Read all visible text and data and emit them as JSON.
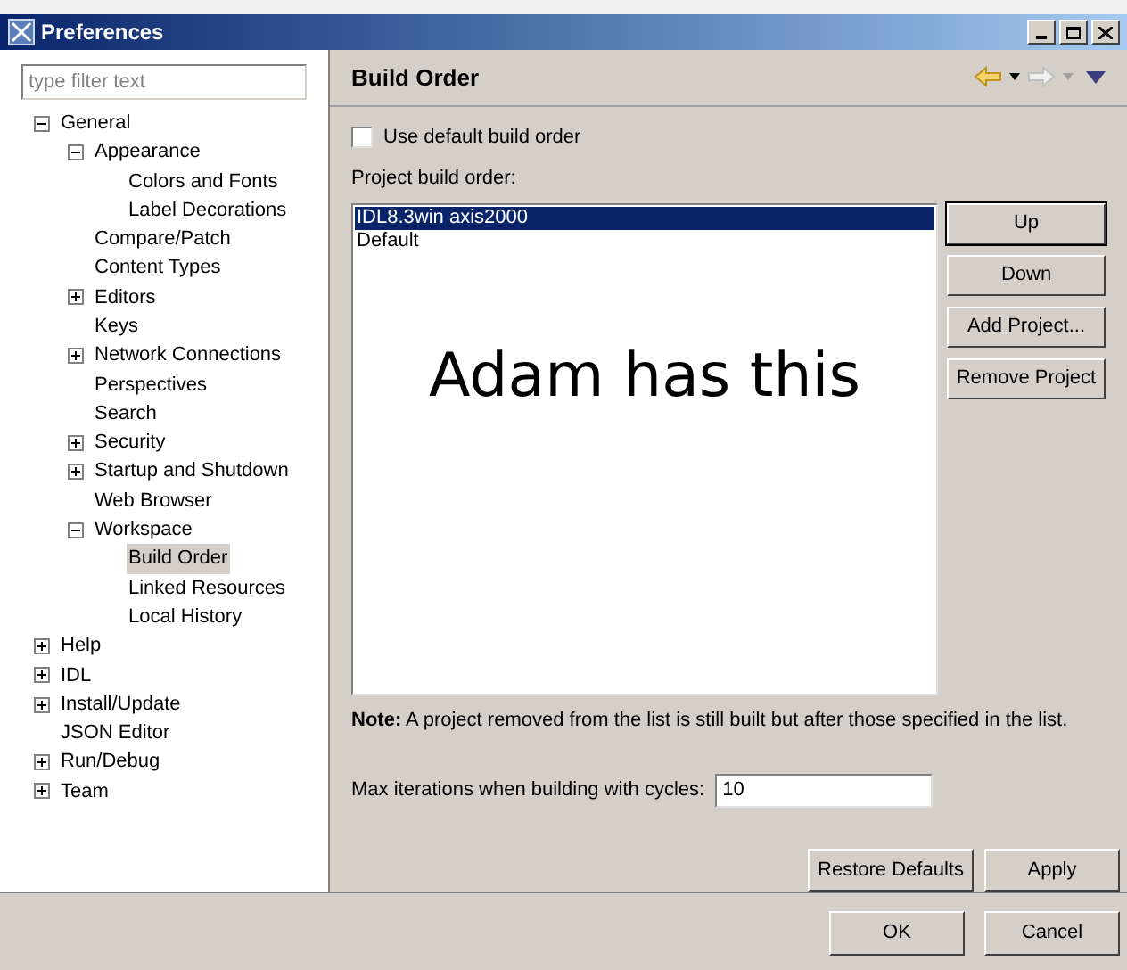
{
  "window": {
    "title": "Preferences"
  },
  "filter": {
    "placeholder": "type filter text"
  },
  "tree": [
    {
      "label": "General",
      "expanded": true,
      "selected": false,
      "children": [
        {
          "label": "Appearance",
          "expanded": true,
          "selected": false,
          "children": [
            {
              "label": "Colors and Fonts",
              "selected": false
            },
            {
              "label": "Label Decorations",
              "selected": false
            }
          ]
        },
        {
          "label": "Compare/Patch",
          "selected": false
        },
        {
          "label": "Content Types",
          "selected": false
        },
        {
          "label": "Editors",
          "expanded": false,
          "selected": false
        },
        {
          "label": "Keys",
          "selected": false
        },
        {
          "label": "Network Connections",
          "expanded": false,
          "selected": false
        },
        {
          "label": "Perspectives",
          "selected": false
        },
        {
          "label": "Search",
          "selected": false
        },
        {
          "label": "Security",
          "expanded": false,
          "selected": false
        },
        {
          "label": "Startup and Shutdown",
          "expanded": false,
          "selected": false
        },
        {
          "label": "Web Browser",
          "selected": false
        },
        {
          "label": "Workspace",
          "expanded": true,
          "selected": false,
          "children": [
            {
              "label": "Build Order",
              "selected": true
            },
            {
              "label": "Linked Resources",
              "selected": false
            },
            {
              "label": "Local History",
              "selected": false
            }
          ]
        }
      ]
    },
    {
      "label": "Help",
      "expanded": false,
      "selected": false
    },
    {
      "label": "IDL",
      "expanded": false,
      "selected": false
    },
    {
      "label": "Install/Update",
      "expanded": false,
      "selected": false
    },
    {
      "label": "JSON Editor",
      "selected": false
    },
    {
      "label": "Run/Debug",
      "expanded": false,
      "selected": false
    },
    {
      "label": "Team",
      "expanded": false,
      "selected": false
    }
  ],
  "page": {
    "title": "Build Order",
    "use_default": {
      "label": "Use default build order",
      "checked": false
    },
    "list_label": "Project build order:",
    "projects": [
      {
        "label": "IDL8.3win axis2000",
        "selected": true
      },
      {
        "label": "Default",
        "selected": false
      }
    ],
    "annotation": "Adam has this",
    "side_buttons": [
      "Up",
      "Down",
      "Add Project...",
      "Remove Project"
    ],
    "note": "**Note:** A project removed from the list is still built but after those specified in the list.",
    "max_iterations": {
      "label": "Max iterations when building with cycles:",
      "value": "10"
    },
    "buttons": [
      "Restore Defaults",
      "Apply"
    ]
  },
  "dialog_buttons": [
    "OK",
    "Cancel"
  ]
}
